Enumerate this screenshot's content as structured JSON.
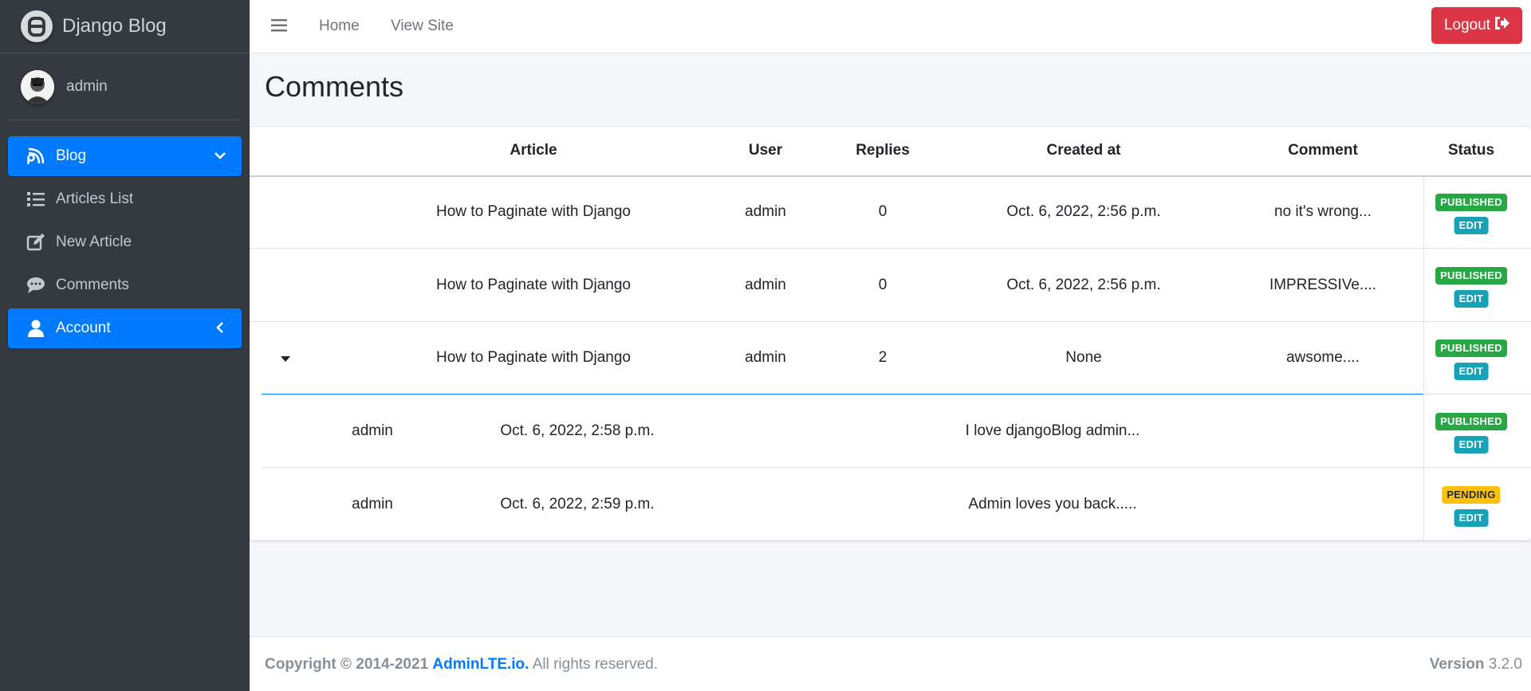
{
  "brand": {
    "title": "Django Blog"
  },
  "user": {
    "name": "admin"
  },
  "sidebar": {
    "items": [
      {
        "label": "Blog",
        "icon": "blog-icon",
        "active": true
      },
      {
        "label": "Articles List",
        "icon": "list-icon",
        "active": false
      },
      {
        "label": "New Article",
        "icon": "edit-icon",
        "active": false
      },
      {
        "label": "Comments",
        "icon": "comments-icon",
        "active": false
      },
      {
        "label": "Account",
        "icon": "user-icon",
        "active": true
      }
    ]
  },
  "topnav": {
    "home": "Home",
    "view_site": "View Site",
    "logout": "Logout"
  },
  "page": {
    "title": "Comments"
  },
  "table": {
    "headers": [
      "Article",
      "User",
      "Replies",
      "Created at",
      "Comment",
      "Status"
    ],
    "rows": [
      {
        "article": "How to Paginate with Django",
        "user": "admin",
        "replies": "0",
        "created": "Oct. 6, 2022, 2:56 p.m.",
        "comment": "no it's wrong...",
        "status": "PUBLISHED",
        "edit": "EDIT"
      },
      {
        "article": "How to Paginate with Django",
        "user": "admin",
        "replies": "0",
        "created": "Oct. 6, 2022, 2:56 p.m.",
        "comment": "IMPRESSIVe....",
        "status": "PUBLISHED",
        "edit": "EDIT"
      },
      {
        "article": "How to Paginate with Django",
        "user": "admin",
        "replies": "2",
        "created": "None",
        "comment": "awsome....",
        "status": "PUBLISHED",
        "edit": "EDIT"
      }
    ],
    "replies": [
      {
        "user": "admin",
        "created": "Oct. 6, 2022, 2:58 p.m.",
        "comment": "I love djangoBlog admin...",
        "status": "PUBLISHED",
        "edit": "EDIT"
      },
      {
        "user": "admin",
        "created": "Oct. 6, 2022, 2:59 p.m.",
        "comment": "Admin loves you back.....",
        "status": "PENDING",
        "edit": "EDIT"
      }
    ]
  },
  "footer": {
    "copyright": "Copyright © 2014-2021",
    "link": "AdminLTE.io.",
    "rights": "All rights reserved.",
    "version_label": "Version",
    "version": "3.2.0"
  },
  "colors": {
    "primary": "#007bff",
    "danger": "#dc3545",
    "success": "#28a745",
    "info": "#17a2b8",
    "warning": "#ffc107",
    "sidebar": "#343a40"
  }
}
